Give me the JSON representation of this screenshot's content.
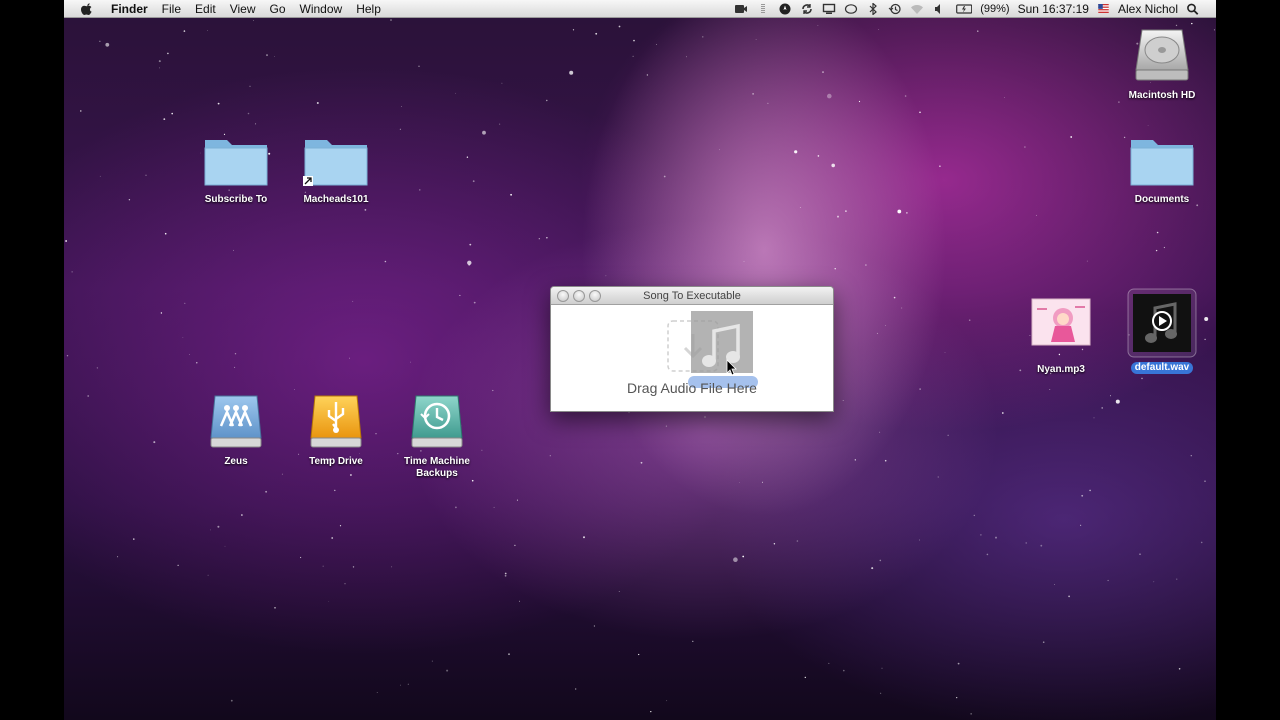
{
  "menubar": {
    "app_name": "Finder",
    "items": [
      "File",
      "Edit",
      "View",
      "Go",
      "Window",
      "Help"
    ],
    "battery": "(99%)",
    "clock": "Sun 16:37:19",
    "user": "Alex Nichol"
  },
  "desktop": {
    "icons": {
      "macintosh_hd": "Macintosh HD",
      "subscribe_to": "Subscribe To",
      "macheads101": "Macheads101",
      "documents": "Documents",
      "zeus": "Zeus",
      "temp_drive": "Temp Drive",
      "time_machine": "Time Machine\nBackups",
      "nyan": "Nyan.mp3",
      "default_wav": "default.wav"
    }
  },
  "window": {
    "title": "Song To Executable",
    "drop_label": "Drag Audio File Here"
  },
  "colors": {
    "selection": "#3875d7",
    "folder": "#8ec6ea",
    "usb_drive": "#f2a81d",
    "time_machine": "#5fb3a8"
  }
}
